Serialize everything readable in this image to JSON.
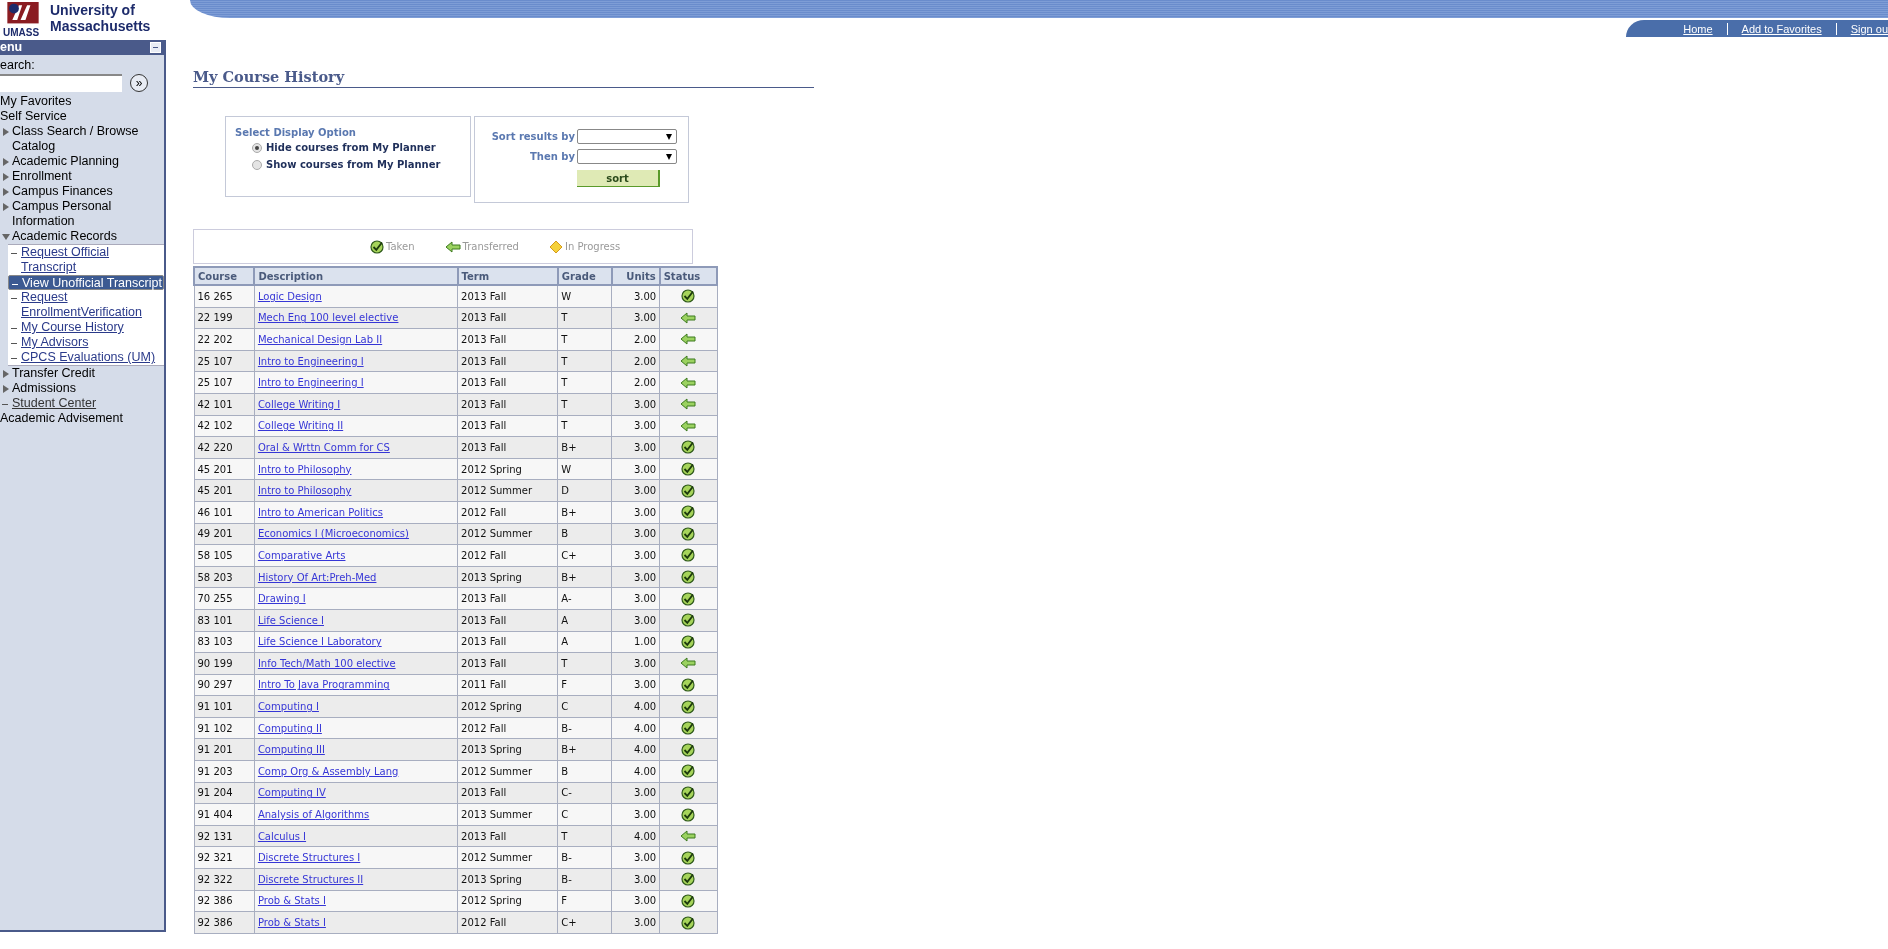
{
  "header": {
    "logo_wordmark": "UMASS",
    "logo_title_line1": "University of",
    "logo_title_line2": "Massachusetts",
    "links": [
      "Home",
      "Add to Favorites",
      "Sign ou"
    ]
  },
  "sidebar": {
    "title": "enu",
    "search_label": "earch:",
    "search_button": "»",
    "items": [
      {
        "label": "My Favorites",
        "kind": "plain"
      },
      {
        "label": "Self Service",
        "kind": "plain"
      },
      {
        "label": "Class Search / Browse Catalog",
        "kind": "folder",
        "expanded": false
      },
      {
        "label": "Academic Planning",
        "kind": "folder",
        "expanded": false
      },
      {
        "label": "Enrollment",
        "kind": "folder",
        "expanded": false
      },
      {
        "label": "Campus Finances",
        "kind": "folder",
        "expanded": false
      },
      {
        "label": "Campus Personal Information",
        "kind": "folder",
        "expanded": false
      },
      {
        "label": "Academic Records",
        "kind": "folder",
        "expanded": true,
        "children": [
          {
            "label": "Request Official Transcript",
            "selected": false
          },
          {
            "label": "View Unofficial Transcript",
            "selected": true
          },
          {
            "label": "Request EnrollmentVerification",
            "selected": false
          },
          {
            "label": "My Course History",
            "selected": false
          },
          {
            "label": "My Advisors",
            "selected": false
          },
          {
            "label": "CPCS Evaluations (UM)",
            "selected": false
          }
        ]
      },
      {
        "label": "Transfer Credit",
        "kind": "folder",
        "expanded": false
      },
      {
        "label": "Admissions",
        "kind": "folder",
        "expanded": false
      },
      {
        "label": "Student Center",
        "kind": "link"
      },
      {
        "label": "Academic Advisement",
        "kind": "plain"
      }
    ]
  },
  "page_title": "My Course History",
  "display_option": {
    "title": "Select Display Option",
    "options": [
      {
        "label": "Hide courses from My Planner",
        "selected": true
      },
      {
        "label": "Show courses from My Planner",
        "selected": false
      }
    ]
  },
  "sort": {
    "sort_label": "Sort results by",
    "then_label": "Then by",
    "button": "sort"
  },
  "legend": [
    {
      "label": "Taken",
      "kind": "taken"
    },
    {
      "label": "Transferred",
      "kind": "transferred"
    },
    {
      "label": "In Progress",
      "kind": "in_progress"
    }
  ],
  "table": {
    "columns": [
      "Course",
      "Description",
      "Term",
      "Grade",
      "Units",
      "Status"
    ],
    "rows": [
      {
        "course": "16 265",
        "description": "Logic Design",
        "term": "2013 Fall",
        "grade": "W",
        "units": "3.00",
        "kind": "taken"
      },
      {
        "course": "22 199",
        "description": "Mech Eng 100 level elective",
        "term": "2013 Fall",
        "grade": "T",
        "units": "3.00",
        "kind": "transferred"
      },
      {
        "course": "22 202",
        "description": "Mechanical Design Lab II",
        "term": "2013 Fall",
        "grade": "T",
        "units": "2.00",
        "kind": "transferred"
      },
      {
        "course": "25 107",
        "description": "Intro to Engineering I",
        "term": "2013 Fall",
        "grade": "T",
        "units": "2.00",
        "kind": "transferred"
      },
      {
        "course": "25 107",
        "description": "Intro to Engineering I",
        "term": "2013 Fall",
        "grade": "T",
        "units": "2.00",
        "kind": "transferred"
      },
      {
        "course": "42 101",
        "description": "College Writing I",
        "term": "2013 Fall",
        "grade": "T",
        "units": "3.00",
        "kind": "transferred"
      },
      {
        "course": "42 102",
        "description": "College Writing II",
        "term": "2013 Fall",
        "grade": "T",
        "units": "3.00",
        "kind": "transferred"
      },
      {
        "course": "42 220",
        "description": "Oral & Wrttn Comm for CS",
        "term": "2013 Fall",
        "grade": "B+",
        "units": "3.00",
        "kind": "taken"
      },
      {
        "course": "45 201",
        "description": "Intro to Philosophy",
        "term": "2012 Spring",
        "grade": "W",
        "units": "3.00",
        "kind": "taken"
      },
      {
        "course": "45 201",
        "description": "Intro to Philosophy",
        "term": "2012 Summer",
        "grade": "D",
        "units": "3.00",
        "kind": "taken"
      },
      {
        "course": "46 101",
        "description": "Intro to American Politics",
        "term": "2012 Fall",
        "grade": "B+",
        "units": "3.00",
        "kind": "taken"
      },
      {
        "course": "49 201",
        "description": "Economics I (Microeconomics)",
        "term": "2012 Summer",
        "grade": "B",
        "units": "3.00",
        "kind": "taken"
      },
      {
        "course": "58 105",
        "description": "Comparative Arts",
        "term": "2012 Fall",
        "grade": "C+",
        "units": "3.00",
        "kind": "taken"
      },
      {
        "course": "58 203",
        "description": "History Of Art:Preh-Med",
        "term": "2013 Spring",
        "grade": "B+",
        "units": "3.00",
        "kind": "taken"
      },
      {
        "course": "70 255",
        "description": "Drawing I",
        "term": "2013 Fall",
        "grade": "A-",
        "units": "3.00",
        "kind": "taken"
      },
      {
        "course": "83 101",
        "description": "Life Science I",
        "term": "2013 Fall",
        "grade": "A",
        "units": "3.00",
        "kind": "taken"
      },
      {
        "course": "83 103",
        "description": "Life Science I Laboratory",
        "term": "2013 Fall",
        "grade": "A",
        "units": "1.00",
        "kind": "taken"
      },
      {
        "course": "90 199",
        "description": "Info Tech/Math 100 elective",
        "term": "2013 Fall",
        "grade": "T",
        "units": "3.00",
        "kind": "transferred"
      },
      {
        "course": "90 297",
        "description": "Intro To Java Programming",
        "term": "2011 Fall",
        "grade": "F",
        "units": "3.00",
        "kind": "taken"
      },
      {
        "course": "91 101",
        "description": "Computing I",
        "term": "2012 Spring",
        "grade": "C",
        "units": "4.00",
        "kind": "taken"
      },
      {
        "course": "91 102",
        "description": "Computing II",
        "term": "2012 Fall",
        "grade": "B-",
        "units": "4.00",
        "kind": "taken"
      },
      {
        "course": "91 201",
        "description": "Computing III",
        "term": "2013 Spring",
        "grade": "B+",
        "units": "4.00",
        "kind": "taken"
      },
      {
        "course": "91 203",
        "description": "Comp Org & Assembly Lang",
        "term": "2012 Summer",
        "grade": "B",
        "units": "4.00",
        "kind": "taken"
      },
      {
        "course": "91 204",
        "description": "Computing IV",
        "term": "2013 Fall",
        "grade": "C-",
        "units": "3.00",
        "kind": "taken"
      },
      {
        "course": "91 404",
        "description": "Analysis of Algorithms",
        "term": "2013 Summer",
        "grade": "C",
        "units": "3.00",
        "kind": "taken"
      },
      {
        "course": "92 131",
        "description": "Calculus I",
        "term": "2013 Fall",
        "grade": "T",
        "units": "4.00",
        "kind": "transferred"
      },
      {
        "course": "92 321",
        "description": "Discrete Structures I",
        "term": "2012 Summer",
        "grade": "B-",
        "units": "3.00",
        "kind": "taken"
      },
      {
        "course": "92 322",
        "description": "Discrete Structures II",
        "term": "2013 Spring",
        "grade": "B-",
        "units": "3.00",
        "kind": "taken"
      },
      {
        "course": "92 386",
        "description": "Prob & Stats I",
        "term": "2012 Spring",
        "grade": "F",
        "units": "3.00",
        "kind": "taken"
      },
      {
        "course": "92 386",
        "description": "Prob & Stats I",
        "term": "2012 Fall",
        "grade": "C+",
        "units": "3.00",
        "kind": "taken"
      }
    ]
  }
}
